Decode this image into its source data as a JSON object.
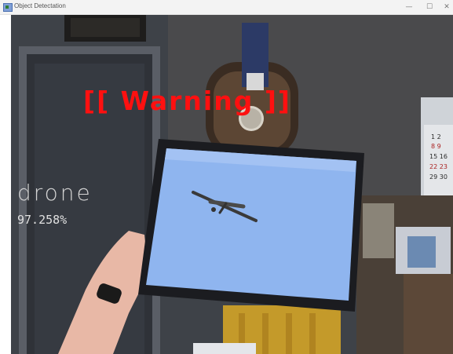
{
  "window": {
    "title": "Object Detectation",
    "minimize_glyph": "—",
    "maximize_glyph": "☐",
    "close_glyph": "✕"
  },
  "overlay": {
    "warning": "[[ Warning ]]",
    "class_label": "drone",
    "confidence": "97.258%"
  },
  "colors": {
    "warning": "#ff1010",
    "label": "#d4d4d4"
  },
  "icons": [
    "app-icon",
    "airplane-icon"
  ]
}
